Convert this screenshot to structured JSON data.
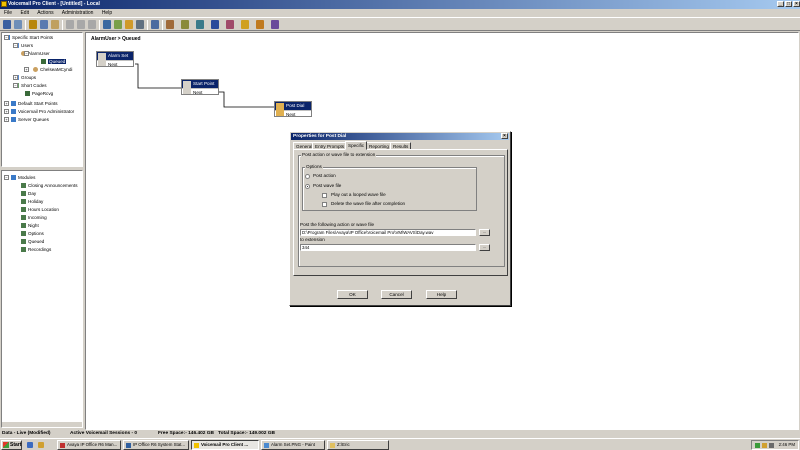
{
  "window": {
    "title": "Voicemail Pro Client - [Untitled] - Local",
    "min": "_",
    "max": "□",
    "close": "×"
  },
  "menu": [
    "File",
    "Edit",
    "Actions",
    "Administration",
    "Help"
  ],
  "tree_top": {
    "items": [
      {
        "label": "Specific Start Points",
        "level": 0,
        "expander": "−"
      },
      {
        "label": "Users",
        "level": 1,
        "expander": "−"
      },
      {
        "label": "AlarmUser",
        "level": 2,
        "expander": "−"
      },
      {
        "label": "Queued",
        "level": 3,
        "selected": true
      },
      {
        "label": "ChelseaMCyndi",
        "level": 2,
        "expander": "+"
      },
      {
        "label": "Groups",
        "level": 1,
        "expander": "+"
      },
      {
        "label": "Short Codes",
        "level": 1,
        "expander": "−"
      },
      {
        "label": "PageRcvg",
        "level": 2
      },
      {
        "label": "Default Start Points",
        "level": 0,
        "expander": "+"
      },
      {
        "label": "Voicemail Pro Administrator",
        "level": 0,
        "expander": "+"
      },
      {
        "label": "Server Queues",
        "level": 0,
        "expander": "+"
      }
    ]
  },
  "tree_bottom": {
    "root": "Modules",
    "items": [
      "Closing Announcements",
      "Day",
      "Holiday",
      "Hours Location",
      "Incoming",
      "Night",
      "Options",
      "Queued",
      "Recordings"
    ]
  },
  "canvas": {
    "breadcrumb": "AlarmUser > Queued",
    "nodes": [
      {
        "title": "Alarm Set",
        "next": "Next"
      },
      {
        "title": "Start Point",
        "next": "Next"
      },
      {
        "title": "Post Dial",
        "next": "Next"
      }
    ]
  },
  "dialog": {
    "title": "Properties for Post Dial",
    "close": "×",
    "tabs": [
      "General",
      "Entry Prompts",
      "Specific",
      "Reporting",
      "Results"
    ],
    "active_tab": "Specific",
    "group_title": "Post action or wave file to extension",
    "options_title": "Options",
    "radio_post_action": "Post action",
    "radio_post_wave": "Post wave file",
    "chk_loop": "Play out a looped wave file",
    "chk_delete": "Delete the wave file after completion",
    "post_label": "Post the following action or wave file",
    "post_value": "D:\\Program Files\\Avaya\\IP Office\\Voicemail Pro\\VM\\WAVS\\Day.wav",
    "ext_label": "to extension",
    "ext_value": "344",
    "browse": "...",
    "ok": "OK",
    "cancel": "Cancel",
    "help": "Help"
  },
  "status": {
    "state": "Data - Live (Modified)",
    "sessions": "Active Voicemail Sessions - 0",
    "free": "Free Space:- 146.402 GB",
    "total": "Total Space:- 149.002 GB"
  },
  "taskbar": {
    "start": "Start",
    "tasks": [
      "Avaya IP Office R6 Man...",
      "IP Office R6 System Stat...",
      "Voicemail Pro Client ...",
      "Alarm Set.PNG - Paint",
      "Z:\\Eric"
    ],
    "active_index": 2,
    "clock": "2:46 PM"
  },
  "colors": {
    "title_blue": "#0a246a",
    "face": "#d4d0c8",
    "select": "#0a246a"
  }
}
